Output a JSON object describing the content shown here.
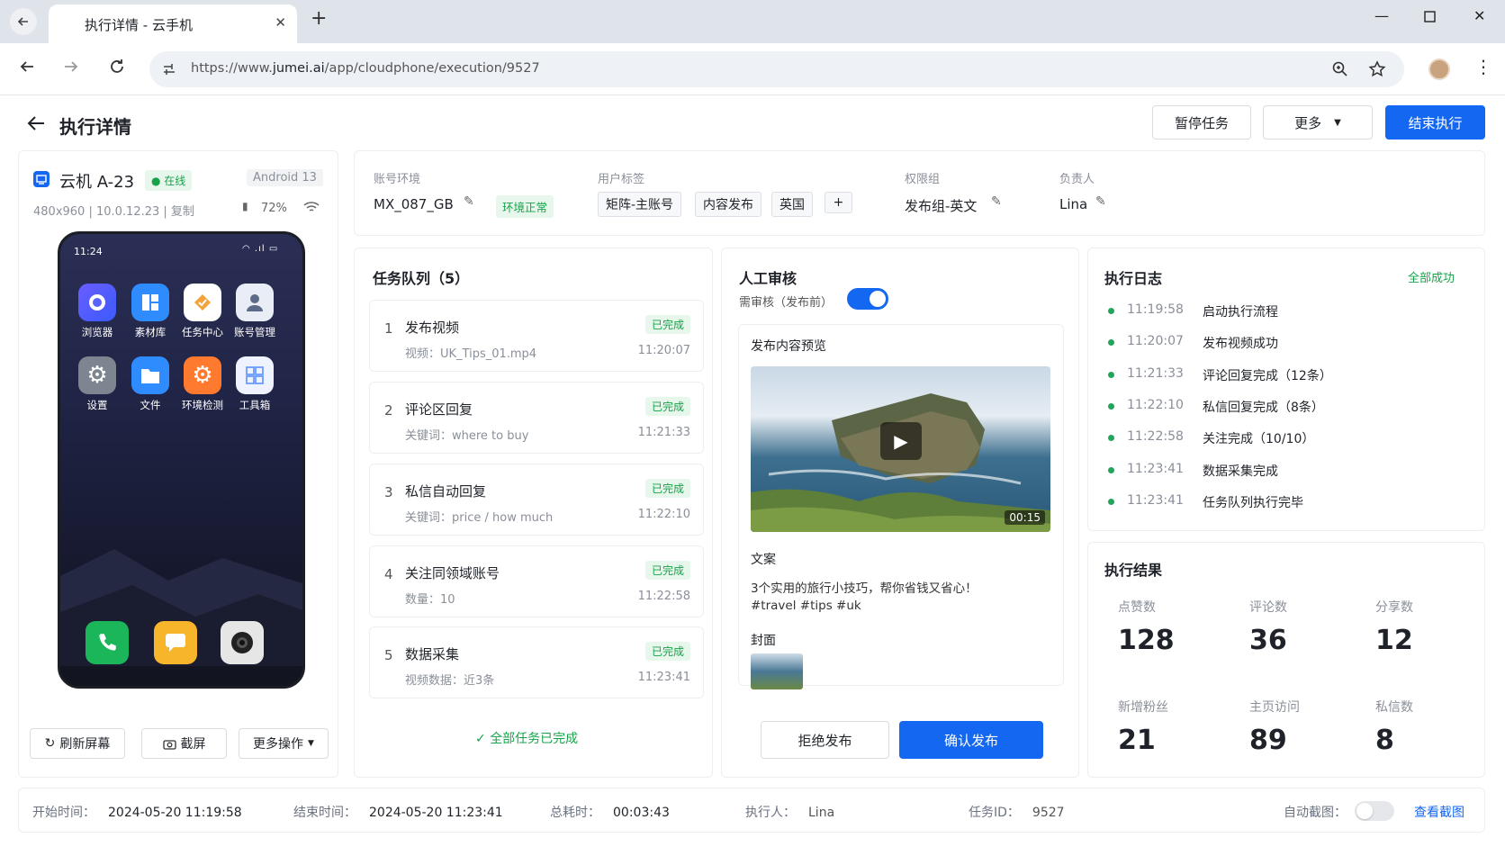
{
  "browser": {
    "tab_title": "执行详情 - 云手机",
    "url_prefix": "https://www.",
    "url_domain": "jumei.ai",
    "url_path": "/app/cloudphone/execution/9527"
  },
  "page": {
    "title": "执行详情",
    "pause_label": "暂停任务",
    "more_label": "更多",
    "end_label": "结束执行"
  },
  "device": {
    "name": "云机 A-23",
    "status": "在线",
    "os": "Android 13",
    "info": "480x960 | 10.0.12.23 | 复制",
    "battery": "72%",
    "phone_time": "11:24",
    "apps": [
      "浏览器",
      "素材库",
      "任务中心",
      "账号管理",
      "设置",
      "文件",
      "环境检测",
      "工具箱"
    ],
    "refresh_label": "刷新屏幕",
    "screenshot_label": "截屏",
    "more_ops_label": "更多操作"
  },
  "account": {
    "env_label": "账号环境",
    "env_value": "MX_087_GB",
    "env_status": "环境正常",
    "tags_label": "用户标签",
    "tags": [
      "矩阵-主账号",
      "内容发布",
      "英国"
    ],
    "add_tag": "+",
    "perm_label": "权限组",
    "perm_value": "发布组-英文",
    "owner_label": "负责人",
    "owner_value": "Lina"
  },
  "queue": {
    "title": "任务队列（5）",
    "tasks": [
      {
        "num": "1",
        "name": "发布视频",
        "sub": "视频：UK_Tips_01.mp4",
        "status": "已完成",
        "time": "11:20:07"
      },
      {
        "num": "2",
        "name": "评论区回复",
        "sub": "关键词：where to buy",
        "status": "已完成",
        "time": "11:21:33"
      },
      {
        "num": "3",
        "name": "私信自动回复",
        "sub": "关键词：price / how much",
        "status": "已完成",
        "time": "11:22:10"
      },
      {
        "num": "4",
        "name": "关注同领域账号",
        "sub": "数量：10",
        "status": "已完成",
        "time": "11:22:58"
      },
      {
        "num": "5",
        "name": "数据采集",
        "sub": "视频数据：近3条",
        "status": "已完成",
        "time": "11:23:41"
      }
    ],
    "all_done": "全部任务已完成"
  },
  "review": {
    "title": "人工审核",
    "toggle_label": "需审核（发布前）",
    "preview_title": "发布内容预览",
    "duration": "00:15",
    "copy_label": "文案",
    "copy_line1": "3个实用的旅行小技巧，帮你省钱又省心！",
    "copy_line2": "#travel #tips #uk",
    "cover_label": "封面",
    "reject_label": "拒绝发布",
    "confirm_label": "确认发布"
  },
  "log": {
    "title": "执行日志",
    "status": "全部成功",
    "entries": [
      {
        "time": "11:19:58",
        "msg": "启动执行流程"
      },
      {
        "time": "11:20:07",
        "msg": "发布视频成功"
      },
      {
        "time": "11:21:33",
        "msg": "评论回复完成（12条）"
      },
      {
        "time": "11:22:10",
        "msg": "私信回复完成（8条）"
      },
      {
        "time": "11:22:58",
        "msg": "关注完成（10/10）"
      },
      {
        "time": "11:23:41",
        "msg": "数据采集完成"
      },
      {
        "time": "11:23:41",
        "msg": "任务队列执行完毕"
      }
    ]
  },
  "results": {
    "title": "执行结果",
    "stats": [
      {
        "label": "点赞数",
        "value": "128"
      },
      {
        "label": "评论数",
        "value": "36"
      },
      {
        "label": "分享数",
        "value": "12"
      },
      {
        "label": "新增粉丝",
        "value": "21"
      },
      {
        "label": "主页访问",
        "value": "89"
      },
      {
        "label": "私信数",
        "value": "8"
      }
    ]
  },
  "footer": {
    "start_label": "开始时间：",
    "start_value": "2024-05-20 11:19:58",
    "end_label": "结束时间：",
    "end_value": "2024-05-20 11:23:41",
    "duration_label": "总耗时：",
    "duration_value": "00:03:43",
    "executor_label": "执行人：",
    "executor_value": "Lina",
    "taskid_label": "任务ID：",
    "taskid_value": "9527",
    "auto_shot_label": "自动截图：",
    "view_shot_label": "查看截图"
  },
  "colors": {
    "accent": "#1467f0",
    "success": "#17a34a"
  }
}
